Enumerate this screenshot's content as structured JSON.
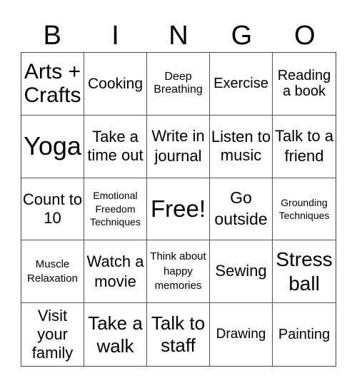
{
  "header": {
    "letters": [
      "B",
      "I",
      "N",
      "G",
      "O"
    ]
  },
  "board": {
    "cells": [
      "Arts + Crafts",
      "Cooking",
      "Deep Breathing",
      "Exercise",
      "Reading a book",
      "Yoga",
      "Take a time out",
      "Write in journal",
      "Listen to music",
      "Talk to a friend",
      "Count to 10",
      "Emotional Freedom Techniques",
      "Free!",
      "Go outside",
      "Grounding Techniques",
      "Muscle Relaxation",
      "Watch a movie",
      "Think about happy memories",
      "Sewing",
      "Stress ball",
      "Visit your family",
      "Take a walk",
      "Talk to staff",
      "Drawing",
      "Painting"
    ]
  }
}
